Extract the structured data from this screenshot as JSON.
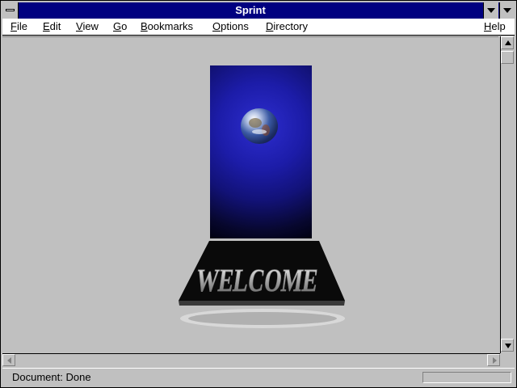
{
  "window": {
    "title": "Sprint"
  },
  "menu": {
    "items": [
      {
        "pre": "",
        "u": "F",
        "post": "ile"
      },
      {
        "pre": "",
        "u": "E",
        "post": "dit"
      },
      {
        "pre": "",
        "u": "V",
        "post": "iew"
      },
      {
        "pre": "",
        "u": "G",
        "post": "o"
      },
      {
        "pre": "",
        "u": "B",
        "post": "ookmarks"
      },
      {
        "pre": "",
        "u": "O",
        "post": "ptions"
      },
      {
        "pre": "",
        "u": "D",
        "post": "irectory"
      },
      {
        "pre": "",
        "u": "H",
        "post": "elp"
      }
    ]
  },
  "content": {
    "welcome_text": "WELCOME"
  },
  "status": {
    "text": "Document: Done"
  },
  "colors": {
    "titlebar": "#000080",
    "background": "#c0c0c0",
    "banner": "#1c1ca8"
  },
  "icons": [
    "system-menu-icon",
    "minimize-icon",
    "maximize-icon",
    "scroll-up-icon",
    "scroll-down-icon",
    "scroll-left-icon",
    "scroll-right-icon",
    "globe-icon"
  ]
}
